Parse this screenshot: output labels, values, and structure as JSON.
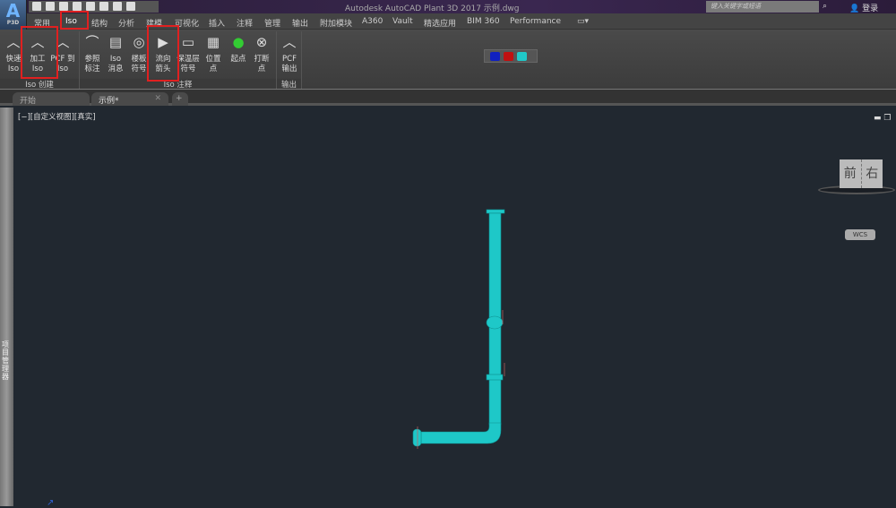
{
  "app": {
    "logo": "A",
    "logo_sub": "P3D",
    "title": "Autodesk AutoCAD Plant 3D 2017    示例.dwg"
  },
  "search": {
    "placeholder": "键入关键字或短语"
  },
  "user": {
    "login": "登录"
  },
  "menu_tabs": [
    {
      "label": "常用"
    },
    {
      "label": "Iso"
    },
    {
      "label": "结构"
    },
    {
      "label": "分析"
    },
    {
      "label": "建模"
    },
    {
      "label": "可视化"
    },
    {
      "label": "插入"
    },
    {
      "label": "注释"
    },
    {
      "label": "管理"
    },
    {
      "label": "输出"
    },
    {
      "label": "附加模块"
    },
    {
      "label": "A360"
    },
    {
      "label": "Vault"
    },
    {
      "label": "精选应用"
    },
    {
      "label": "BIM 360"
    },
    {
      "label": "Performance"
    }
  ],
  "active_tab": "Iso",
  "ribbon": {
    "buttons": [
      {
        "label1": "快速",
        "label2": "Iso",
        "icon": "iso-chevron-icon"
      },
      {
        "label1": "加工",
        "label2": "Iso",
        "icon": "iso-chevron-icon"
      },
      {
        "label1": "PCF 到",
        "label2": "Iso",
        "icon": "pcf-to-iso-icon"
      },
      {
        "label1": "参照",
        "label2": "标注",
        "icon": "reference-annotation-icon"
      },
      {
        "label1": "Iso",
        "label2": "消息",
        "icon": "iso-message-icon"
      },
      {
        "label1": "楼板",
        "label2": "符号",
        "icon": "floor-symbol-icon"
      },
      {
        "label1": "流向",
        "label2": "箭头",
        "icon": "flow-arrow-icon"
      },
      {
        "label1": "保温层",
        "label2": "符号",
        "icon": "insulation-symbol-icon"
      },
      {
        "label1": "位置",
        "label2": "点",
        "icon": "location-point-icon"
      },
      {
        "label1": "起点",
        "label2": "",
        "icon": "start-point-icon"
      },
      {
        "label1": "打断",
        "label2": "点",
        "icon": "break-point-icon"
      },
      {
        "label1": "PCF",
        "label2": "输出",
        "icon": "pcf-export-icon"
      }
    ],
    "panels": [
      {
        "label": "Iso 创建"
      },
      {
        "label": "Iso 注释"
      },
      {
        "label": "输出"
      }
    ]
  },
  "doc_tabs": [
    {
      "label": "开始"
    },
    {
      "label": "示例*"
    }
  ],
  "viewport": {
    "label": "[−][自定义视图][真实]",
    "viewcube_front": "前",
    "viewcube_right": "右",
    "wcs": "WCS",
    "pipe_color": "#1ec8c8",
    "background": "#212830"
  },
  "palette": {
    "label": "项目管理器"
  },
  "highlight_color": "#e02020"
}
